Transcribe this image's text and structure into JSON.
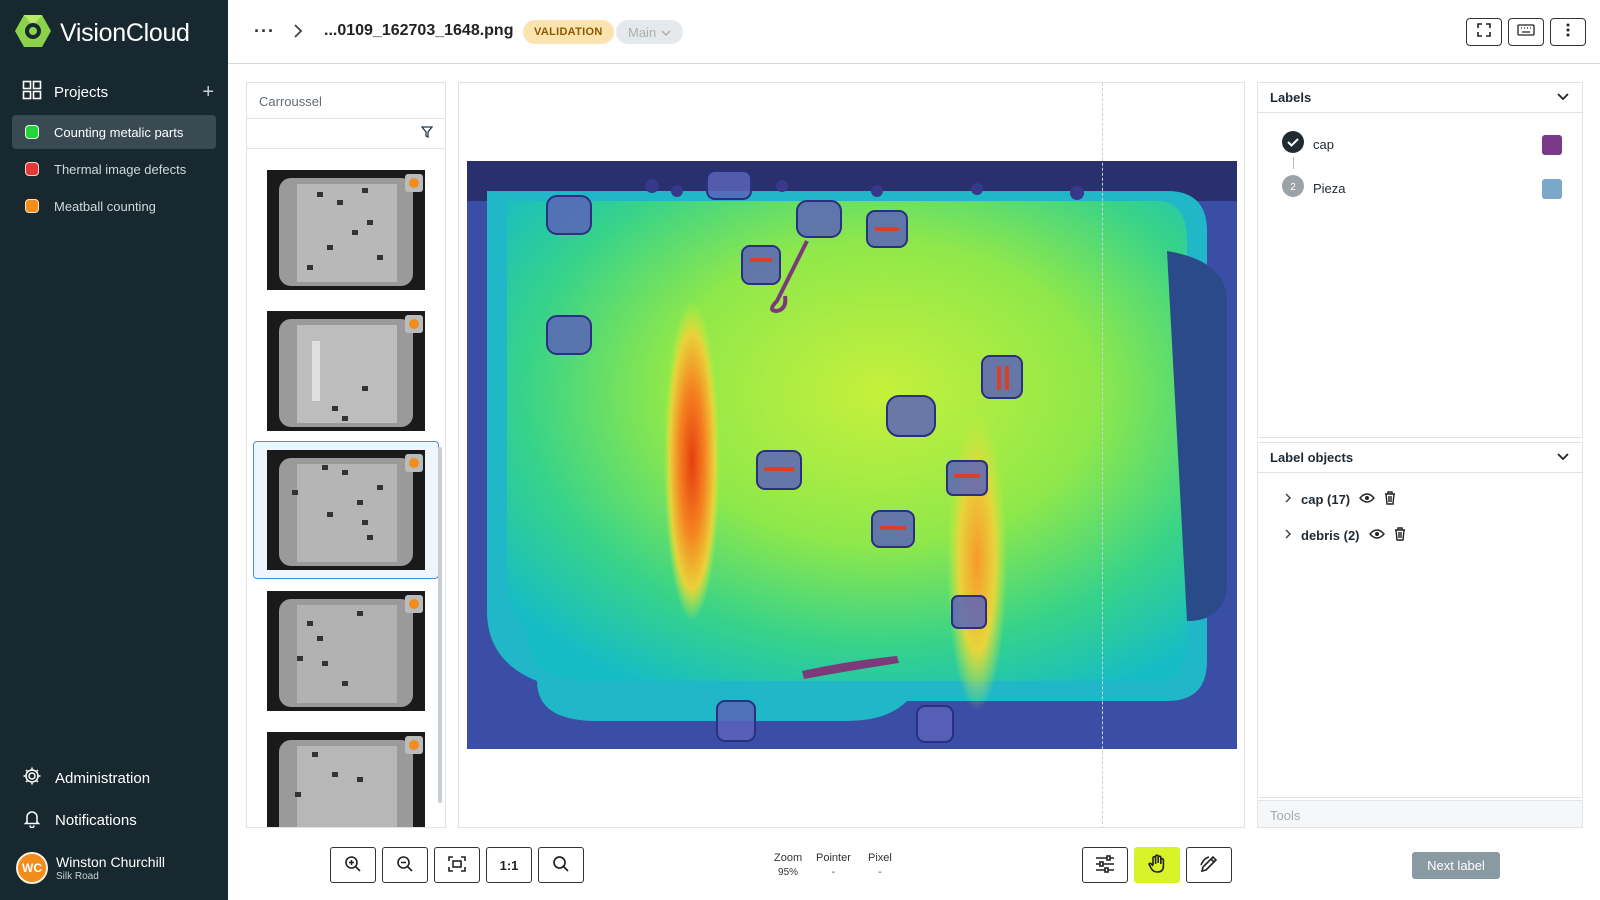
{
  "app": {
    "name": "VisionCloud"
  },
  "sidebar": {
    "projects_label": "Projects",
    "projects": [
      {
        "name": "Counting metalic parts",
        "color": "#22d63a",
        "active": true
      },
      {
        "name": "Thermal image defects",
        "color": "#e53935",
        "active": false
      },
      {
        "name": "Meatball counting",
        "color": "#f28c1c",
        "active": false
      }
    ],
    "administration_label": "Administration",
    "notifications_label": "Notifications",
    "user": {
      "initials": "WC",
      "name": "Winston Churchill",
      "org": "Silk Road"
    }
  },
  "topbar": {
    "filename": "...0109_162703_1648.png",
    "status_badge": "VALIDATION",
    "branch": "Main"
  },
  "carousel": {
    "title": "Carroussel",
    "thumbnails": [
      {
        "selected": false
      },
      {
        "selected": false
      },
      {
        "selected": true
      },
      {
        "selected": false
      },
      {
        "selected": false
      }
    ]
  },
  "labels_panel": {
    "title": "Labels",
    "labels": [
      {
        "name": "cap",
        "marker": "check",
        "color": "#7a3a8a"
      },
      {
        "name": "Pieza",
        "marker": "2",
        "color": "#7ba7c8"
      }
    ]
  },
  "label_objects_panel": {
    "title": "Label objects",
    "items": [
      {
        "label": "cap (17)"
      },
      {
        "label": "debris (2)"
      }
    ]
  },
  "tools_label": "Tools",
  "toolbar": {
    "actual_size_label": "1:1",
    "zoom_label": "Zoom",
    "zoom_value": "95%",
    "pointer_label": "Pointer",
    "pointer_value": "-",
    "pixel_label": "Pixel",
    "pixel_value": "-",
    "next_label": "Next label"
  }
}
